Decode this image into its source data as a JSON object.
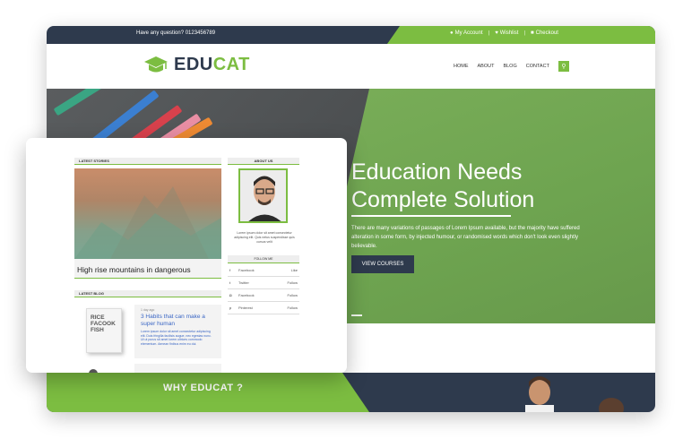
{
  "site": {
    "topbar": {
      "question": "Have any question? 0123456789",
      "links": [
        {
          "icon": "user-icon",
          "label": "My Account"
        },
        {
          "icon": "heart-icon",
          "label": "Wishlist"
        },
        {
          "icon": "lock-icon",
          "label": "Checkout"
        }
      ]
    },
    "logo": {
      "part1": "EDU",
      "part2": "CAT"
    },
    "nav": [
      "HOME",
      "ABOUT",
      "BLOG",
      "CONTACT"
    ],
    "hero": {
      "title_line1": "Education Needs",
      "title_line2": "Complete Solution",
      "description": "There are many variations of passages of Lorem Ipsum available, but the majority have suffered alteration in some form, by injected humour, or randomised words which don't look even slightly believable.",
      "button": "VIEW COURSES"
    },
    "why": {
      "title": "WHY EDUCAT ?"
    }
  },
  "card": {
    "latest_stories": {
      "heading": "LATEST STORIES",
      "title": "High rise mountains in dangerous"
    },
    "latest_blog": {
      "heading": "LATEST BLOG",
      "book_text": [
        "RICE",
        "FACOOK",
        "FISH"
      ],
      "date": "1 day ago",
      "title": "3 Habits that can make a super human",
      "excerpt": "Lorem ipsum dolor sit amet consectetur adipiscing elit. Duis fringilla facilisis augue, nec egestas nunc. Ut ut purus sit amet lorem ultrices commodo elementum. Aenean finibus enim eu dui."
    },
    "about": {
      "heading": "ABOUT US",
      "text": "Lorem ipsum dolor sit amet consectetur adipiscing elit. Quis netus suspendisse quis cursus velit"
    },
    "follow": {
      "heading": "FOLLOW ME",
      "rows": [
        {
          "icon": "facebook-icon",
          "glyph": "f",
          "name": "Facebook",
          "action": "Like"
        },
        {
          "icon": "twitter-icon",
          "glyph": "t",
          "name": "Twitter",
          "action": "Follow"
        },
        {
          "icon": "instagram-icon",
          "glyph": "◘",
          "name": "Facebook",
          "action": "Follow"
        },
        {
          "icon": "pinterest-icon",
          "glyph": "p",
          "name": "Pinterest",
          "action": "Follow"
        }
      ]
    }
  },
  "colors": {
    "accent": "#7cbd41",
    "dark": "#2e3a4d",
    "link": "#3a66c4"
  }
}
